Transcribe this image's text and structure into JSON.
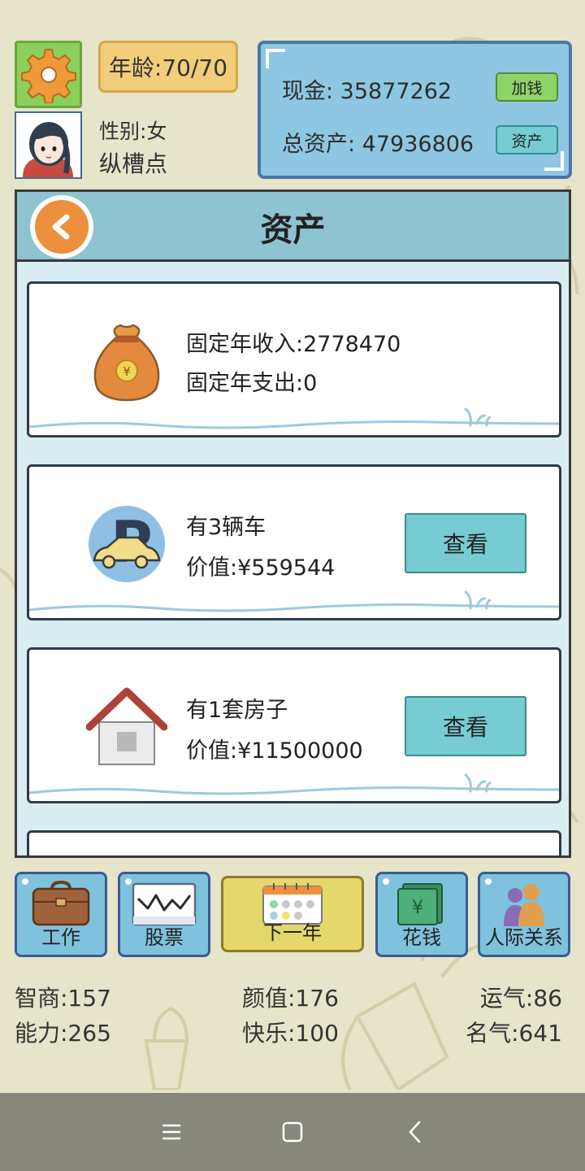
{
  "header": {
    "age_text": "年龄:70/70",
    "gender_text": "性别:女",
    "nickname": "纵槽点"
  },
  "money": {
    "cash_text": "现金: 35877262",
    "add_money_label": "加钱",
    "total_assets_text": "总资产: 47936806",
    "assets_label": "资产"
  },
  "assets_panel": {
    "title": "资产",
    "cards": [
      {
        "icon": "money-bag-icon",
        "line1": "固定年收入:2778470",
        "line2": "固定年支出:0"
      },
      {
        "icon": "parking-car-icon",
        "line1": "有3辆车",
        "line2": "价值:¥559544",
        "button": "查看"
      },
      {
        "icon": "house-icon",
        "line1": "有1套房子",
        "line2": "价值:¥11500000",
        "button": "查看"
      }
    ]
  },
  "nav": [
    {
      "label": "工作",
      "icon": "briefcase-icon"
    },
    {
      "label": "股票",
      "icon": "stock-chart-icon"
    },
    {
      "label": "下一年",
      "icon": "calendar-icon"
    },
    {
      "label": "花钱",
      "icon": "cash-stack-icon"
    },
    {
      "label": "人际关系",
      "icon": "people-icon"
    }
  ],
  "stats": {
    "iq": "智商:157",
    "looks": "颜值:176",
    "luck": "运气:86",
    "ability": "能力:265",
    "happiness": "快乐:100",
    "fame": "名气:641"
  },
  "colors": {
    "background": "#e6e4c9",
    "gear_green": "#8ccf5a",
    "age_orange": "#f2cd7a",
    "money_panel_blue": "#8dc7e2",
    "view_button": "#77ccd3",
    "next_year_yellow": "#e4d76c"
  }
}
